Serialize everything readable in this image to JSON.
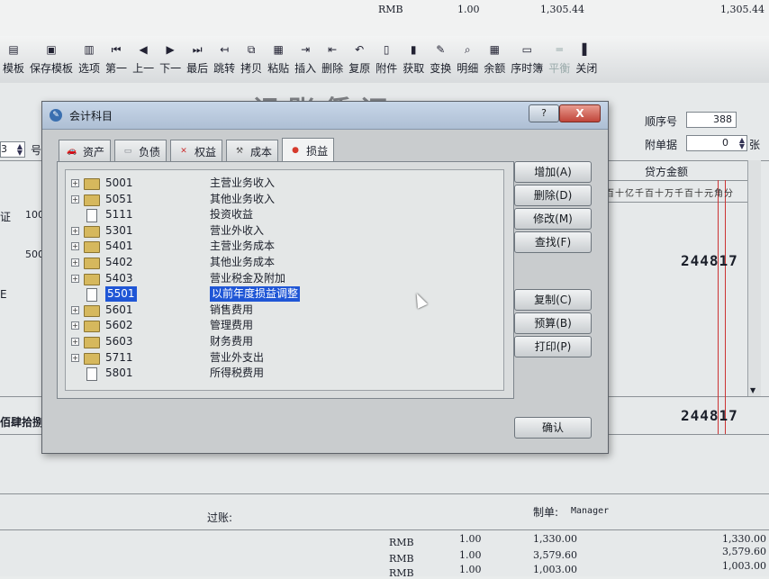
{
  "toolbar": {
    "items": [
      {
        "label": "模板",
        "icon": "template-icon"
      },
      {
        "label": "保存模板",
        "icon": "save-template-icon"
      },
      {
        "label": "选项",
        "icon": "options-icon"
      },
      {
        "label": "第一",
        "icon": "first-icon"
      },
      {
        "label": "上一",
        "icon": "previous-icon"
      },
      {
        "label": "下一",
        "icon": "next-icon"
      },
      {
        "label": "最后",
        "icon": "last-icon"
      },
      {
        "label": "跳转",
        "icon": "jump-icon"
      },
      {
        "label": "拷贝",
        "icon": "copy-icon"
      },
      {
        "label": "粘贴",
        "icon": "paste-icon"
      },
      {
        "label": "插入",
        "icon": "insert-icon"
      },
      {
        "label": "删除",
        "icon": "delete-icon"
      },
      {
        "label": "复原",
        "icon": "restore-icon"
      },
      {
        "label": "附件",
        "icon": "attachment-icon"
      },
      {
        "label": "获取",
        "icon": "fetch-icon"
      },
      {
        "label": "变换",
        "icon": "transform-icon"
      },
      {
        "label": "明细",
        "icon": "detail-icon"
      },
      {
        "label": "余额",
        "icon": "balance-icon"
      },
      {
        "label": "序时簿",
        "icon": "journal-icon"
      },
      {
        "label": "平衡",
        "icon": "balance-scale-icon"
      },
      {
        "label": "关闭",
        "icon": "close-door-icon"
      }
    ]
  },
  "voucher": {
    "title": "记账凭证",
    "seq_label": "顺序号",
    "seq_value": "388",
    "attach_label": "附单据",
    "attach_value": "0",
    "attach_unit": "张",
    "left_num": "3",
    "left_num_label": "号",
    "credit_title": "贷方金额",
    "units": "百十亿千百十万千百十元角分",
    "amount_1": "244817",
    "amount_2": "244817",
    "frag_cert": "证",
    "frag_100": "100",
    "frag_500": "500",
    "frag_e": "E",
    "frag_total": "佰肆拾捌元",
    "post_label": "过账:",
    "maker_label": "制单:",
    "maker_value": "Manager"
  },
  "top_strip": {
    "cur": "RMB",
    "rate": "1.00",
    "amount": "1,305.44",
    "amount_right": "1,305.44"
  },
  "bottom_rows": [
    {
      "cur": "RMB",
      "rate": "1.00",
      "amount": "1,330.00",
      "right": "1,330.00"
    },
    {
      "cur": "RMB",
      "rate": "1.00",
      "amount": "3,579.60",
      "right": "3,579.60"
    },
    {
      "cur": "RMB",
      "rate": "1.00",
      "amount": "1,003.00",
      "right": "1,003.00"
    }
  ],
  "dialog": {
    "title": "会计科目",
    "help": "?",
    "close": "X",
    "tabs": [
      {
        "label": "资产",
        "icon": "car-icon",
        "color": "#b8352a"
      },
      {
        "label": "负债",
        "icon": "card-icon",
        "color": "#7a7f86"
      },
      {
        "label": "权益",
        "icon": "document-icon",
        "color": "#c33"
      },
      {
        "label": "成本",
        "icon": "tool-icon",
        "color": "#555"
      },
      {
        "label": "损益",
        "icon": "apple-icon",
        "color": "#d63a2c"
      }
    ],
    "active_tab": 4,
    "accounts": [
      {
        "code": "5001",
        "name": "主营业务收入",
        "type": "folder"
      },
      {
        "code": "5051",
        "name": "其他业务收入",
        "type": "folder"
      },
      {
        "code": "5111",
        "name": "投资收益",
        "type": "doc"
      },
      {
        "code": "5301",
        "name": "营业外收入",
        "type": "folder"
      },
      {
        "code": "5401",
        "name": "主营业务成本",
        "type": "folder"
      },
      {
        "code": "5402",
        "name": "其他业务成本",
        "type": "folder"
      },
      {
        "code": "5403",
        "name": "营业税金及附加",
        "type": "folder"
      },
      {
        "code": "5501",
        "name": "以前年度损益调整",
        "type": "doc",
        "selected": true
      },
      {
        "code": "5601",
        "name": "销售费用",
        "type": "folder"
      },
      {
        "code": "5602",
        "name": "管理费用",
        "type": "folder"
      },
      {
        "code": "5603",
        "name": "财务费用",
        "type": "folder"
      },
      {
        "code": "5711",
        "name": "营业外支出",
        "type": "folder"
      },
      {
        "code": "5801",
        "name": "所得税费用",
        "type": "doc"
      }
    ],
    "buttons": {
      "add": "增加(A)",
      "delete": "删除(D)",
      "modify": "修改(M)",
      "find": "查找(F)",
      "copy": "复制(C)",
      "budget": "预算(B)",
      "print": "打印(P)",
      "ok": "确认"
    }
  },
  "colors": {
    "selection": "#1f56d6",
    "close_button": "#c0453a",
    "titlebar": "#b8c8dc"
  }
}
